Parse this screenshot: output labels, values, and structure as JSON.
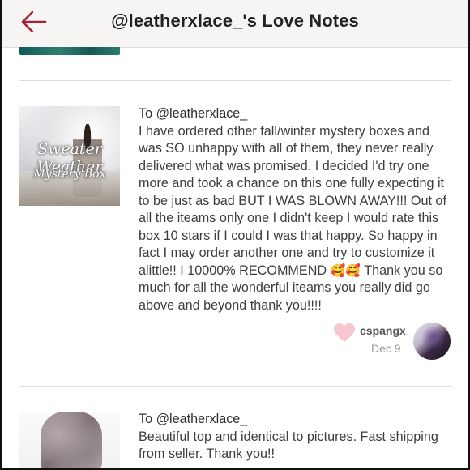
{
  "header": {
    "title": "@leatherxlace_'s Love Notes",
    "back_icon": "back-arrow-icon",
    "accent_color": "#a3243a"
  },
  "notes": [
    {
      "recipient": "To @leatherxlace_",
      "message": "I have ordered other fall/winter mystery boxes and was SO unhappy with all of them, they never really delivered what was promised. I decided I'd try one more and took a chance on this one fully expecting it to be just as bad BUT I WAS BLOWN AWAY!!! Out of all the iteams only one I didn't keep I would rate this box 10 stars if I could I was that happy. So happy in fact I may order another one and try to customize it alittle!! I 10000% RECOMMEND",
      "emojis": "🥰🥰",
      "message_end": "Thank you so much for all the wonderful iteams you really did go above and beyond thank you!!!!",
      "thumbnail_text_line1": "Sweater Weather",
      "thumbnail_text_line2": "Mystery Box",
      "author": "cspangx",
      "date": "Dec 9",
      "heart_icon": "heart-icon",
      "heart_color": "#f7c6cf"
    },
    {
      "recipient": "To @leatherxlace_",
      "message": "Beautiful top and identical to pictures. Fast shipping from seller. Thank you!!"
    }
  ]
}
